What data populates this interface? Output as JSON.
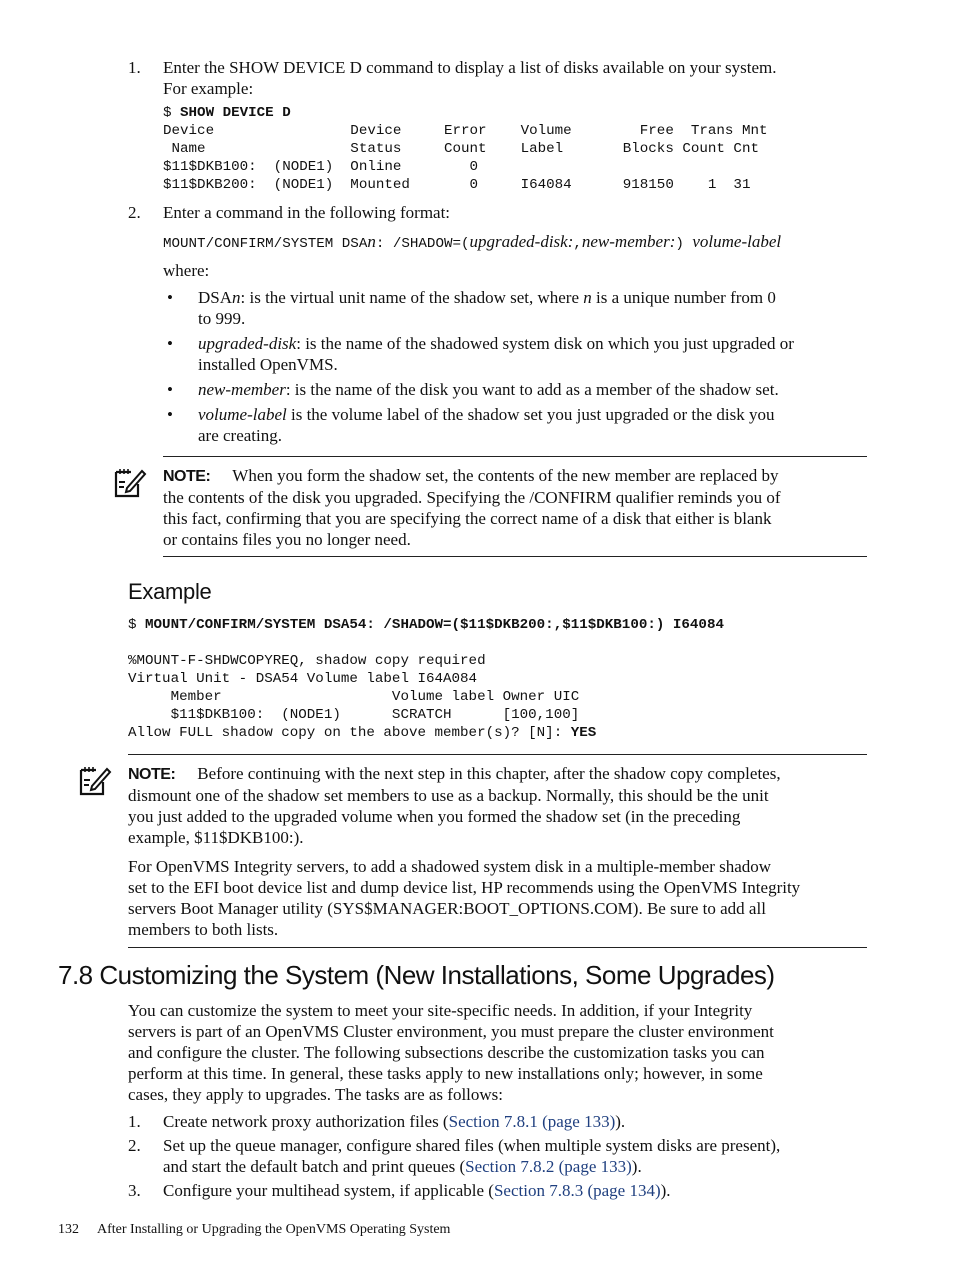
{
  "steps": [
    {
      "number": "1.",
      "text_line1": "Enter the SHOW DEVICE D command to display a list of disks available on your system.",
      "text_line2": "For example:",
      "command_prompt": "$ ",
      "command": "SHOW DEVICE D",
      "table": {
        "header1": "Device                Device     Error    Volume        Free  Trans Mnt",
        "header2": " Name                 Status     Count    Label       Blocks Count Cnt",
        "rows": [
          "$11$DKB100:  (NODE1)  Online        0",
          "$11$DKB200:  (NODE1)  Mounted       0     I64084      918150    1  31"
        ]
      }
    },
    {
      "number": "2.",
      "text": "Enter a command in the following format:",
      "format_prefix": "MOUNT/CONFIRM/SYSTEM DSA",
      "format_n": "n",
      "format_mid": ": /SHADOW=(",
      "format_arg1": "upgraded-disk:",
      "format_comma": ",",
      "format_arg2": "new-member:",
      "format_close": ")",
      "format_label": "volume-label",
      "where": "where:",
      "bullets": [
        {
          "term": "DSA",
          "term_italic": "n",
          "line1_rest": ": is the virtual unit name of the shadow set, where ",
          "n": "n",
          "line1_end": " is a unique number from 0",
          "line2": "to 999."
        },
        {
          "term_italic": "upgraded-disk",
          "line1_rest": ": is the name of the shadowed system disk on which you just upgraded or",
          "line2": "installed OpenVMS."
        },
        {
          "term_italic": "new-member",
          "line1_rest": ": is the name of the disk you want to add as a member of the shadow set."
        },
        {
          "term_italic": "volume-label",
          "line1_rest": " is the volume label of the shadow set you just upgraded or the disk you",
          "line2": "are creating."
        }
      ]
    }
  ],
  "note1": {
    "icon": "note-pencil-icon",
    "label": "NOTE:",
    "lines": [
      "When you form the shadow set, the contents of the new member are replaced by",
      "the contents of the disk you upgraded. Specifying the /CONFIRM qualifier reminds you of",
      "this fact, confirming that you are specifying the correct name of a disk that either is blank",
      "or contains files you no longer need."
    ]
  },
  "example": {
    "heading": "Example",
    "prompt": "$ ",
    "command": "MOUNT/CONFIRM/SYSTEM DSA54: /SHADOW=($11$DKB200:,$11$DKB100:) I64084",
    "output": [
      "%MOUNT-F-SHDWCOPYREQ, shadow copy required",
      "Virtual Unit - DSA54 Volume label I64A084",
      "     Member                    Volume label Owner UIC",
      "     $11$DKB100:  (NODE1)      SCRATCH      [100,100]"
    ],
    "question": "Allow FULL shadow copy on the above member(s)? [N]: ",
    "answer": "YES"
  },
  "note2": {
    "icon": "note-pencil-icon",
    "label": "NOTE:",
    "para1": [
      "Before continuing with the next step in this chapter, after the shadow copy completes,",
      "dismount one of the shadow set members to use as a backup. Normally, this should be the unit",
      "you just added to the upgraded volume when you formed the shadow set (in the preceding",
      "example, $11$DKB100:)."
    ],
    "para2": [
      "For OpenVMS Integrity servers, to add a shadowed system disk in a multiple-member shadow",
      "set to the EFI boot device list and dump device list, HP recommends using the OpenVMS Integrity",
      "servers Boot Manager utility (SYS$MANAGER:BOOT_OPTIONS.COM). Be sure to add all",
      "members to both lists."
    ]
  },
  "section": {
    "heading": "7.8 Customizing the System (New Installations, Some Upgrades)",
    "intro": [
      "You can customize the system to meet your site-specific needs. In addition, if your Integrity",
      "servers is part of an OpenVMS Cluster environment, you must prepare the cluster environment",
      "and configure the cluster. The following subsections describe the customization tasks you can",
      "perform at this time. In general, these tasks apply to new installations only; however, in some",
      "cases, they apply to upgrades. The tasks are as follows:"
    ],
    "tasks": [
      {
        "number": "1.",
        "line1": "Create network proxy authorization files (",
        "link": "Section 7.8.1 (page 133)",
        "end": ")."
      },
      {
        "number": "2.",
        "line1": "Set up the queue manager, configure shared files (when multiple system disks are present),",
        "line2": "and start the default batch and print queues (",
        "link": "Section 7.8.2 (page 133)",
        "end": ")."
      },
      {
        "number": "3.",
        "line1": "Configure your multihead system, if applicable (",
        "link": "Section 7.8.3 (page 134)",
        "end": ")."
      }
    ]
  },
  "footer": {
    "page_number": "132",
    "title": "After Installing or Upgrading the OpenVMS Operating System"
  },
  "colors": {
    "link": "#1f3f7f",
    "text": "#111111"
  }
}
